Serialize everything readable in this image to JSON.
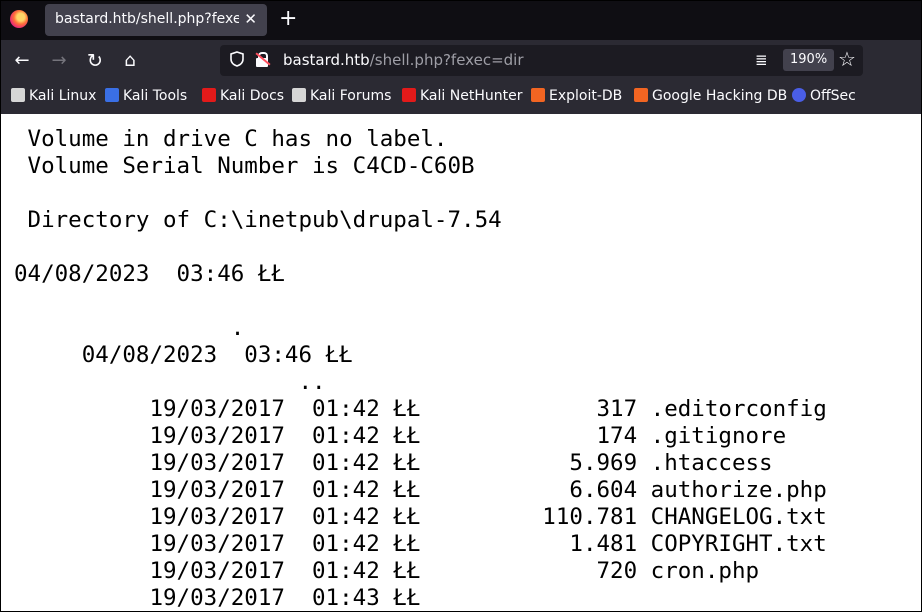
{
  "tab": {
    "title": "bastard.htb/shell.php?fexec=dir",
    "close_glyph": "✕",
    "newtab_glyph": "+"
  },
  "nav": {
    "back": "←",
    "forward": "→",
    "reload": "↻",
    "home": "⌂"
  },
  "urlbar": {
    "host": "bastard.htb",
    "path": "/shell.php?fexec=dir",
    "zoom": "190%",
    "reader_icon": "≣",
    "star": "☆",
    "shield": "🛡"
  },
  "bookmarks": [
    {
      "label": "Kali Linux",
      "icon": "kali-dragon-icon",
      "color": "#d6d6d6"
    },
    {
      "label": "Kali Tools",
      "icon": "kali-tools-icon",
      "color": "#3a6fe5"
    },
    {
      "label": "Kali Docs",
      "icon": "kali-docs-icon",
      "color": "#e31a1a"
    },
    {
      "label": "Kali Forums",
      "icon": "kali-forums-icon",
      "color": "#d6d6d6"
    },
    {
      "label": "Kali NetHunter",
      "icon": "nethunter-icon",
      "color": "#e31a1a"
    },
    {
      "label": "Exploit-DB",
      "icon": "exploit-db-icon",
      "color": "#f26522"
    },
    {
      "label": "Google Hacking DB",
      "icon": "ghdb-icon",
      "color": "#f26522"
    },
    {
      "label": "OffSec",
      "icon": "offsec-icon",
      "color": "#4a5ee6"
    }
  ],
  "output": {
    "text": " Volume in drive C has no label.\n Volume Serial Number is C4CD-C60B\n\n Directory of C:\\inetpub\\drupal-7.54\n\n04/08/2023  03:46 ŁŁ\n\n                .\n     04/08/2023  03:46 ŁŁ\n                     ..\n          19/03/2017  01:42 ŁŁ             317 .editorconfig\n          19/03/2017  01:42 ŁŁ             174 .gitignore\n          19/03/2017  01:42 ŁŁ           5.969 .htaccess\n          19/03/2017  01:42 ŁŁ           6.604 authorize.php\n          19/03/2017  01:42 ŁŁ         110.781 CHANGELOG.txt\n          19/03/2017  01:42 ŁŁ           1.481 COPYRIGHT.txt\n          19/03/2017  01:42 ŁŁ             720 cron.php\n          19/03/2017  01:43 ŁŁ"
  }
}
